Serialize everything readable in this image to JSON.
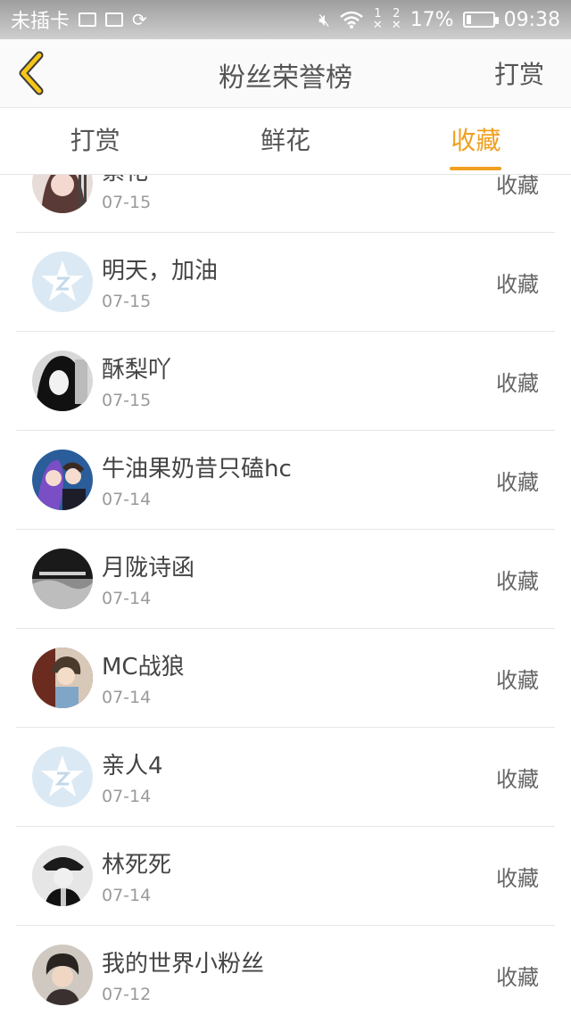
{
  "status_bar": {
    "carrier": "未插卡",
    "battery": "17%",
    "time": "09:38",
    "sim1": "1",
    "sim2": "2"
  },
  "nav": {
    "title": "粉丝荣誉榜",
    "right_action": "打赏"
  },
  "tabs": [
    {
      "label": "打赏",
      "active": false
    },
    {
      "label": "鲜花",
      "active": false
    },
    {
      "label": "收藏",
      "active": true
    }
  ],
  "colors": {
    "accent": "#f0a020",
    "divider": "#e6e6e6"
  },
  "list": [
    {
      "name": "紫花",
      "date": "07-15",
      "action": "收藏",
      "avatar": "anime-girl-avatar"
    },
    {
      "name": "明天，加油",
      "date": "07-15",
      "action": "收藏",
      "avatar": "default-star-avatar"
    },
    {
      "name": "酥梨吖",
      "date": "07-15",
      "action": "收藏",
      "avatar": "bw-anime-avatar"
    },
    {
      "name": "牛油果奶昔只磕hc",
      "date": "07-14",
      "action": "收藏",
      "avatar": "anime-duo-avatar"
    },
    {
      "name": "月陇诗函",
      "date": "07-14",
      "action": "收藏",
      "avatar": "dark-text-avatar"
    },
    {
      "name": "MC战狼",
      "date": "07-14",
      "action": "收藏",
      "avatar": "anime-boy-avatar"
    },
    {
      "name": "亲人4",
      "date": "07-14",
      "action": "收藏",
      "avatar": "default-star-avatar"
    },
    {
      "name": "林死死",
      "date": "07-14",
      "action": "收藏",
      "avatar": "uniform-anime-avatar"
    },
    {
      "name": "我的世界小粉丝",
      "date": "07-12",
      "action": "收藏",
      "avatar": "boy-photo-avatar"
    }
  ]
}
